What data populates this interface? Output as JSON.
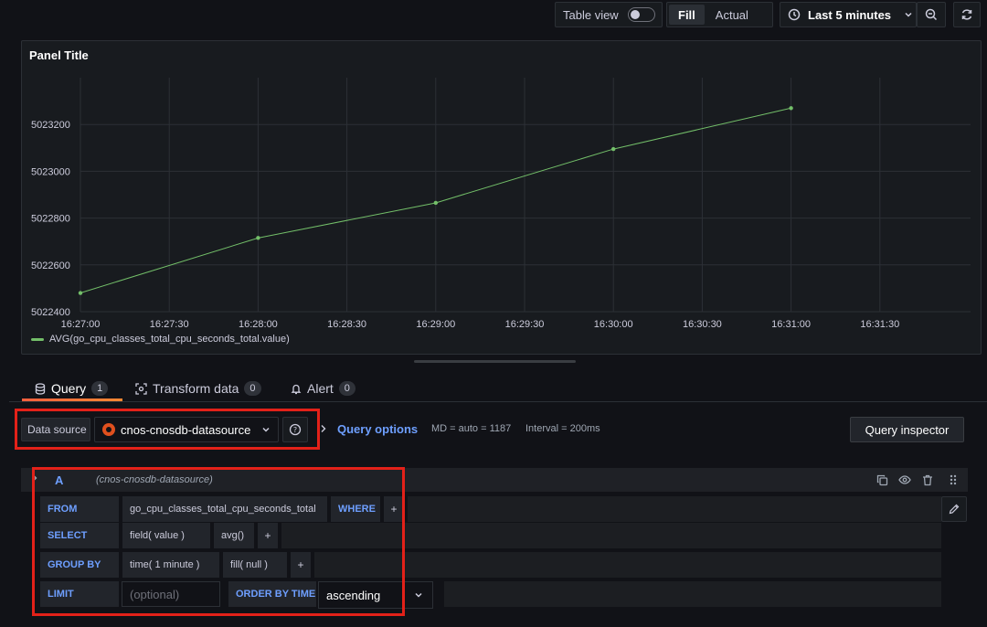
{
  "toolbar": {
    "table_view_label": "Table view",
    "fill_options": [
      "Fill",
      "Actual"
    ],
    "fill_selected": "Fill",
    "time_range": "Last 5 minutes"
  },
  "panel": {
    "title": "Panel Title"
  },
  "chart_data": {
    "type": "line",
    "y_ticks": [
      "5023200",
      "5023000",
      "5022800",
      "5022600",
      "5022400"
    ],
    "x_ticks": [
      "16:27:00",
      "16:27:30",
      "16:28:00",
      "16:28:30",
      "16:29:00",
      "16:29:30",
      "16:30:00",
      "16:30:30",
      "16:31:00",
      "16:31:30"
    ],
    "ylim": [
      5022400,
      5023400
    ],
    "xlim_seconds_from_first_tick": [
      0,
      330
    ],
    "series": [
      {
        "name": "AVG(go_cpu_classes_total_cpu_seconds_total.value)",
        "color": "#73bf69",
        "x": [
          "16:27:00",
          "16:28:00",
          "16:29:00",
          "16:30:00",
          "16:31:00"
        ],
        "values": [
          5022480,
          5022715,
          5022865,
          5023095,
          5023270
        ]
      }
    ],
    "grid": true,
    "legend": "bottom-left"
  },
  "tabs": [
    {
      "label": "Query",
      "count": "1"
    },
    {
      "label": "Transform data",
      "count": "0"
    },
    {
      "label": "Alert",
      "count": "0"
    }
  ],
  "datasource": {
    "label": "Data source",
    "value": "cnos-cnosdb-datasource",
    "help": "?"
  },
  "query_options": {
    "label": "Query options",
    "md": "MD = auto = 1187",
    "interval": "Interval = 200ms",
    "inspector": "Query inspector"
  },
  "query": {
    "ref": "A",
    "datasource_hint": "(cnos-cnosdb-datasource)",
    "from_kw": "FROM",
    "from_value": "go_cpu_classes_total_cpu_seconds_total",
    "where_kw": "WHERE",
    "plus": "+",
    "select_kw": "SELECT",
    "select_field": "field(  value  )",
    "select_agg": "avg()",
    "groupby_kw": "GROUP BY",
    "groupby_time": "time(  1 minute  )",
    "groupby_fill": "fill(  null  )",
    "limit_kw": "LIMIT",
    "limit_placeholder": "(optional)",
    "order_kw": "ORDER BY TIME",
    "order_value": "ascending"
  },
  "colors": {
    "accent_blue": "#6e9fff",
    "series_green": "#73bf69",
    "highlight_red": "#e32119",
    "tab_underline": "#f55f3e"
  }
}
